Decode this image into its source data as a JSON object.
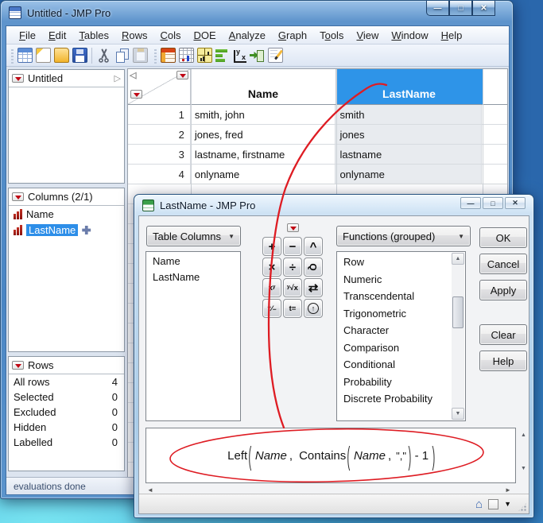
{
  "glyphs": {
    "expand_right": "▷",
    "corner_left": "◁",
    "up": "▲",
    "down": "▼",
    "left": "◄",
    "right": "►",
    "home": "⌂",
    "dropdown": "▼",
    "dd_arrow": "▼"
  },
  "colors": {
    "selected_column_header": "#2E94E8",
    "selection_blue": "#2D8EE8",
    "annotation_red": "#DE1C23",
    "red_triangle": "#C00714"
  },
  "main_window": {
    "title": "Untitled - JMP Pro",
    "window_buttons": [
      {
        "glyph": "—",
        "name": "minimize-button"
      },
      {
        "glyph": "□",
        "name": "maximize-button"
      },
      {
        "glyph": "✕",
        "name": "close-button"
      }
    ],
    "menu_items": [
      {
        "pre": "",
        "u": "F",
        "post": "ile",
        "name": "menu-file"
      },
      {
        "pre": "",
        "u": "E",
        "post": "dit",
        "name": "menu-edit"
      },
      {
        "pre": "",
        "u": "T",
        "post": "ables",
        "name": "menu-tables"
      },
      {
        "pre": "",
        "u": "R",
        "post": "ows",
        "name": "menu-rows"
      },
      {
        "pre": "",
        "u": "C",
        "post": "ols",
        "name": "menu-cols"
      },
      {
        "pre": "",
        "u": "D",
        "post": "OE",
        "name": "menu-doe"
      },
      {
        "pre": "",
        "u": "A",
        "post": "nalyze",
        "name": "menu-analyze"
      },
      {
        "pre": "",
        "u": "G",
        "post": "raph",
        "name": "menu-graph"
      },
      {
        "pre": "T",
        "u": "o",
        "post": "ols",
        "name": "menu-tools"
      },
      {
        "pre": "",
        "u": "V",
        "post": "iew",
        "name": "menu-view"
      },
      {
        "pre": "",
        "u": "W",
        "post": "indow",
        "name": "menu-window"
      },
      {
        "pre": "",
        "u": "H",
        "post": "elp",
        "name": "menu-help"
      }
    ],
    "toolbar_group1": [
      {
        "name": "new-data-table-icon",
        "cls": "ti-new"
      },
      {
        "name": "new-journal-icon",
        "cls": "ti-journal"
      },
      {
        "name": "open-icon",
        "cls": "ti-open"
      },
      {
        "name": "save-icon",
        "cls": "ti-save"
      }
    ],
    "toolbar_group2": [
      {
        "name": "cut-icon",
        "cls": "ti-cut"
      },
      {
        "name": "copy-icon",
        "cls": "ti-copy"
      },
      {
        "name": "paste-icon",
        "cls": "ti-paste dis"
      }
    ],
    "toolbar_group3": [
      {
        "name": "data-table-icon",
        "cls": "ti-table2"
      },
      {
        "name": "summary-statistics-icon",
        "cls": "ti-calc"
      },
      {
        "name": "distribution-icon",
        "cls": "ti-dist"
      },
      {
        "name": "graph-builder-icon",
        "cls": "ti-gbar"
      },
      {
        "name": "fit-y-by-x-icon",
        "cls": "ti-yx"
      },
      {
        "name": "formula-icon",
        "cls": "ti-farrow"
      },
      {
        "name": "script-editor-icon",
        "cls": "ti-script"
      }
    ],
    "panels": {
      "table": {
        "title": "Untitled"
      },
      "columns": {
        "title": "Columns (2/1)",
        "items": [
          {
            "label": "Name"
          },
          {
            "label": "LastName"
          }
        ]
      },
      "rows": {
        "title": "Rows",
        "stats": [
          {
            "label": "All rows",
            "value": "4"
          },
          {
            "label": "Selected",
            "value": "0"
          },
          {
            "label": "Excluded",
            "value": "0"
          },
          {
            "label": "Hidden",
            "value": "0"
          },
          {
            "label": "Labelled",
            "value": "0"
          }
        ]
      }
    },
    "status_text": "evaluations done",
    "grid": {
      "name_header": "Name",
      "lastname_header": "LastName",
      "rows": [
        {
          "num": "1",
          "name": "smith, john",
          "lastname": "smith"
        },
        {
          "num": "2",
          "name": "jones, fred",
          "lastname": "jones"
        },
        {
          "num": "3",
          "name": "lastname, firstname",
          "lastname": "lastname"
        },
        {
          "num": "4",
          "name": "onlyname",
          "lastname": "onlyname"
        }
      ]
    }
  },
  "dialog": {
    "title": "LastName - JMP Pro",
    "window_buttons": [
      {
        "glyph": "—",
        "name": "dialog-minimize-button"
      },
      {
        "glyph": "□",
        "name": "dialog-restore-button"
      },
      {
        "glyph": "✕",
        "name": "dialog-close-button"
      }
    ],
    "table_columns_dropdown": "Table Columns",
    "table_columns": [
      "Name",
      "LastName"
    ],
    "functions_dropdown": "Functions (grouped)",
    "functions": [
      "Row",
      "Numeric",
      "Transcendental",
      "Trigonometric",
      "Character",
      "Comparison",
      "Conditional",
      "Probability",
      "Discrete Probability"
    ],
    "keypad": [
      {
        "glyph": "+",
        "name": "keypad-add-button",
        "cls": "kb"
      },
      {
        "glyph": "−",
        "name": "keypad-subtract-button",
        "cls": "kb"
      },
      {
        "glyph": "^",
        "name": "keypad-power-button",
        "cls": "kb"
      },
      {
        "glyph": "×",
        "name": "keypad-multiply-button",
        "cls": "kb"
      },
      {
        "glyph": "÷",
        "name": "keypad-divide-button",
        "cls": "kb"
      },
      {
        "glyph": "Q",
        "name": "keypad-switch-terms-button",
        "cls": "krot"
      },
      {
        "glyph": "xʸ",
        "name": "keypad-raise-power-button",
        "cls": "ksm"
      },
      {
        "glyph": "ʸ√x",
        "name": "keypad-root-button",
        "cls": "ksm"
      },
      {
        "glyph": "⇄",
        "name": "keypad-swap-button",
        "cls": "kb"
      },
      {
        "glyph": "⁺⁄₋",
        "name": "keypad-sign-button",
        "cls": "ksm"
      },
      {
        "glyph": "t=",
        "name": "keypad-local-variable-button",
        "cls": "ksm"
      },
      {
        "glyph": "↑",
        "name": "keypad-peel-button",
        "cls": "kcirc"
      }
    ],
    "action_buttons_top": [
      {
        "label": "OK",
        "name": "ok-button"
      },
      {
        "label": "Cancel",
        "name": "cancel-button"
      },
      {
        "label": "Apply",
        "name": "apply-button"
      }
    ],
    "action_buttons_bottom": [
      {
        "label": "Clear",
        "name": "clear-button"
      },
      {
        "label": "Help",
        "name": "help-button"
      }
    ],
    "formula_tokens": [
      {
        "t": "Left",
        "type": "fn"
      },
      {
        "t": "(",
        "type": "open"
      },
      {
        "t": "Name",
        "type": "var"
      },
      {
        "t": ",",
        "type": "sep"
      },
      {
        "t": "Contains",
        "type": "fn"
      },
      {
        "t": "(",
        "type": "open"
      },
      {
        "t": "Name",
        "type": "var"
      },
      {
        "t": ",",
        "type": "sep"
      },
      {
        "t": "\",\"",
        "type": "str"
      },
      {
        "t": ")",
        "type": "close"
      },
      {
        "t": "- 1",
        "type": "num"
      },
      {
        "t": ")",
        "type": "close"
      }
    ]
  }
}
